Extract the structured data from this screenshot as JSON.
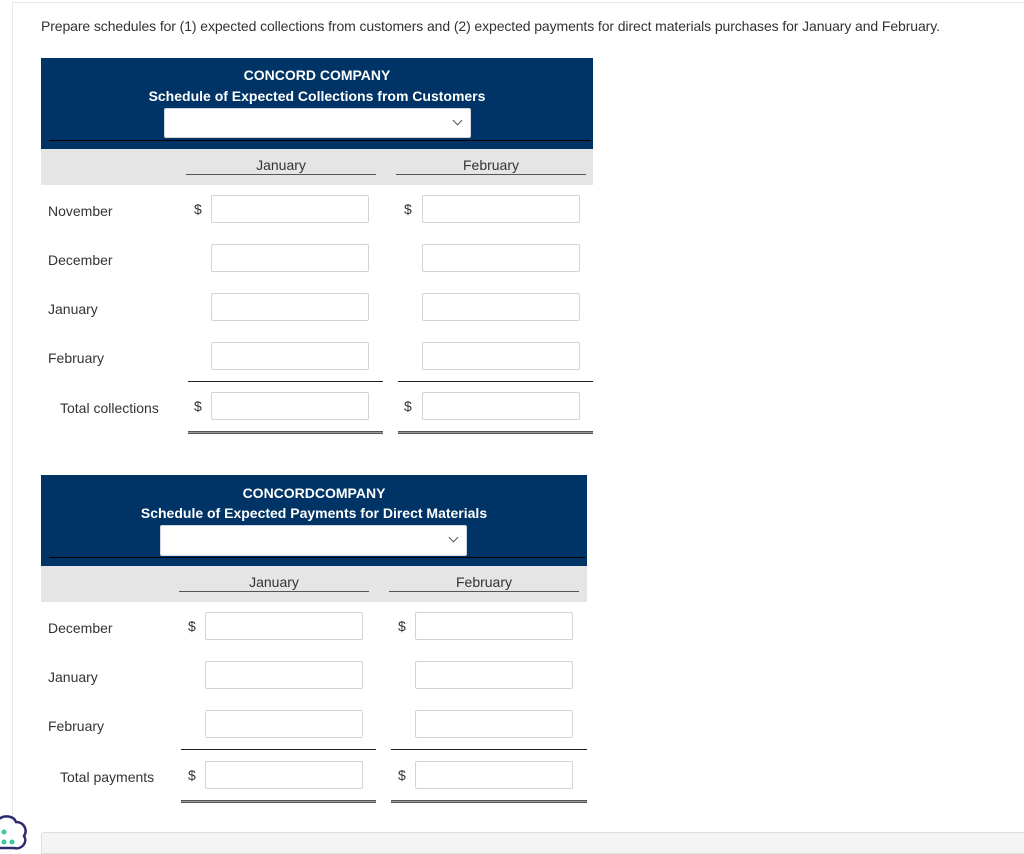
{
  "instructions": "Prepare schedules for (1) expected collections from customers and (2) expected payments for direct materials purchases for January and February.",
  "schedule_collections": {
    "company": "CONCORD COMPANY",
    "title": "Schedule of Expected Collections from Customers",
    "period_select": {
      "value": "",
      "icon": "chevron-down-icon"
    },
    "columns": [
      "January",
      "February"
    ],
    "rows": [
      {
        "label": "November",
        "currency": [
          "$",
          "$"
        ],
        "values": [
          "",
          ""
        ]
      },
      {
        "label": "December",
        "currency": [
          "",
          ""
        ],
        "values": [
          "",
          ""
        ]
      },
      {
        "label": "January",
        "currency": [
          "",
          ""
        ],
        "values": [
          "",
          ""
        ]
      },
      {
        "label": "February",
        "currency": [
          "",
          ""
        ],
        "values": [
          "",
          ""
        ]
      }
    ],
    "total": {
      "label": "Total collections",
      "currency": [
        "$",
        "$"
      ],
      "values": [
        "",
        ""
      ]
    }
  },
  "schedule_payments": {
    "company": "CONCORDCOMPANY",
    "title": "Schedule of Expected Payments for Direct Materials",
    "period_select": {
      "value": "",
      "icon": "chevron-down-icon"
    },
    "columns": [
      "January",
      "February"
    ],
    "rows": [
      {
        "label": "December",
        "currency": [
          "$",
          "$"
        ],
        "values": [
          "",
          ""
        ]
      },
      {
        "label": "January",
        "currency": [
          "",
          ""
        ],
        "values": [
          "",
          ""
        ]
      },
      {
        "label": "February",
        "currency": [
          "",
          ""
        ],
        "values": [
          "",
          ""
        ]
      }
    ],
    "total": {
      "label": "Total payments",
      "currency": [
        "$",
        "$"
      ],
      "values": [
        "",
        ""
      ]
    }
  },
  "bottom_panel": {
    "text": ""
  },
  "colors": {
    "header_bg": "#003366",
    "column_header_bg": "#e5e5e5",
    "accent_dots": "#3cc8a0",
    "blob_outline": "#2e2a6e"
  }
}
